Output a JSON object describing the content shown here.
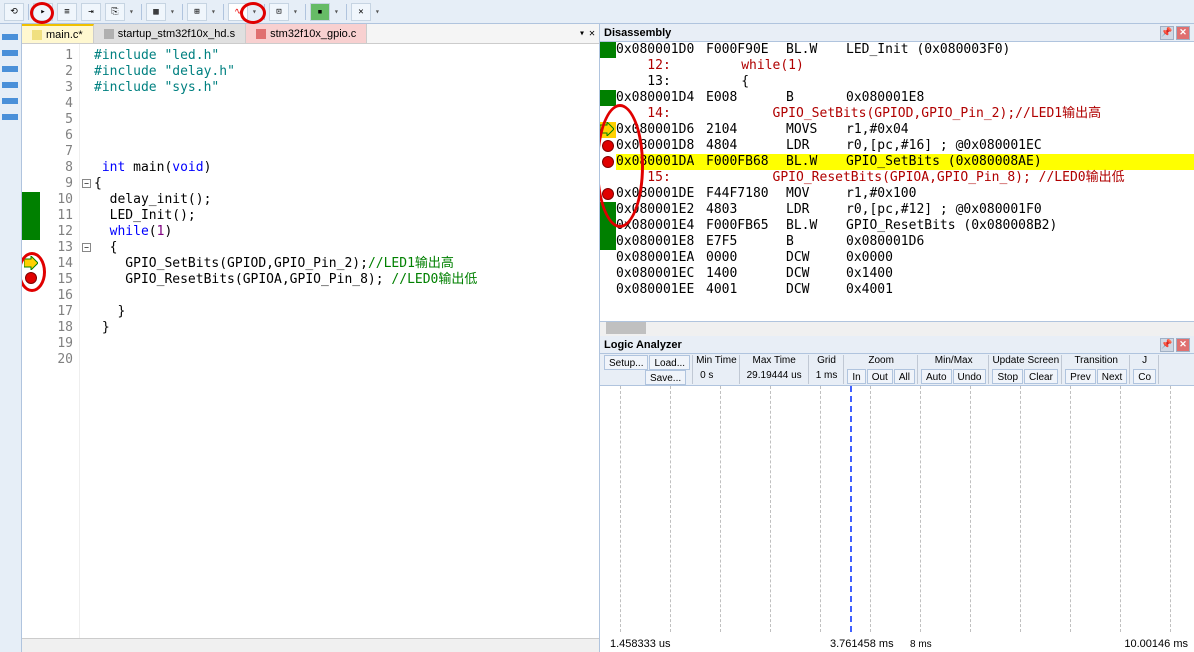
{
  "toolbar": {
    "icons": [
      "reset-icon",
      "run-icon",
      "list-icon",
      "trace-icon",
      "step-icon",
      "window-icon",
      "reg-icon",
      "mem-icon",
      "analyzer-icon",
      "scope-icon",
      "cov-icon",
      "perf-icon",
      "trace2-icon",
      "tools-icon"
    ]
  },
  "tabs": [
    {
      "label": "main.c*",
      "active": true
    },
    {
      "label": "startup_stm32f10x_hd.s",
      "cls": "gray"
    },
    {
      "label": "stm32f10x_gpio.c",
      "cls": "pink"
    }
  ],
  "code": {
    "lines": [
      {
        "n": 1,
        "seg": [
          {
            "t": "#include ",
            "c": "kw-pp"
          },
          {
            "t": "\"led.h\"",
            "c": "kw-str"
          }
        ]
      },
      {
        "n": 2,
        "seg": [
          {
            "t": "#include ",
            "c": "kw-pp"
          },
          {
            "t": "\"delay.h\"",
            "c": "kw-str"
          }
        ]
      },
      {
        "n": 3,
        "seg": [
          {
            "t": "#include ",
            "c": "kw-pp"
          },
          {
            "t": "\"sys.h\"",
            "c": "kw-str"
          }
        ]
      },
      {
        "n": 4,
        "seg": []
      },
      {
        "n": 5,
        "seg": []
      },
      {
        "n": 6,
        "seg": []
      },
      {
        "n": 7,
        "seg": []
      },
      {
        "n": 8,
        "seg": [
          {
            "t": " int ",
            "c": "kw-blue"
          },
          {
            "t": "main",
            "c": ""
          },
          {
            "t": "(",
            "c": ""
          },
          {
            "t": "void",
            "c": "kw-blue"
          },
          {
            "t": ")",
            "c": ""
          }
        ]
      },
      {
        "n": 9,
        "seg": [
          {
            "t": "{",
            "c": ""
          }
        ],
        "fold": true
      },
      {
        "n": 10,
        "seg": [
          {
            "t": "  delay_init();",
            "c": ""
          }
        ]
      },
      {
        "n": 11,
        "seg": [
          {
            "t": "  LED_Init();",
            "c": ""
          }
        ]
      },
      {
        "n": 12,
        "seg": [
          {
            "t": "  ",
            "c": ""
          },
          {
            "t": "while",
            "c": "kw-blue"
          },
          {
            "t": "(",
            "c": ""
          },
          {
            "t": "1",
            "c": "kw-pr"
          },
          {
            "t": ")",
            "c": ""
          }
        ]
      },
      {
        "n": 13,
        "seg": [
          {
            "t": "  {",
            "c": ""
          }
        ],
        "fold": true
      },
      {
        "n": 14,
        "seg": [
          {
            "t": "    GPIO_SetBits(GPIOD,GPIO_Pin_2);",
            "c": ""
          },
          {
            "t": "//LED1输出高",
            "c": "kw-cm"
          }
        ]
      },
      {
        "n": 15,
        "seg": [
          {
            "t": "    GPIO_ResetBits(GPIOA,GPIO_Pin_8); ",
            "c": ""
          },
          {
            "t": "//LED0输出低",
            "c": "kw-cm"
          }
        ]
      },
      {
        "n": 16,
        "seg": []
      },
      {
        "n": 17,
        "seg": [
          {
            "t": "   }",
            "c": ""
          }
        ]
      },
      {
        "n": 18,
        "seg": [
          {
            "t": " }",
            "c": ""
          }
        ]
      },
      {
        "n": 19,
        "seg": []
      },
      {
        "n": 20,
        "seg": []
      }
    ]
  },
  "disasm": {
    "title": "Disassembly",
    "lines": [
      {
        "g": "green",
        "addr": "0x080001D0",
        "hex": "F000F90E",
        "op": "BL.W",
        "args": "LED_Init (0x080003F0)"
      },
      {
        "src": true,
        "t": "    12:         while(1)",
        "c": "dl-red-txt"
      },
      {
        "src": true,
        "t": "    13:         {"
      },
      {
        "g": "green",
        "addr": "0x080001D4",
        "hex": "E008",
        "op": "B",
        "args": "0x080001E8"
      },
      {
        "src": true,
        "t": "    14:             GPIO_SetBits(GPIOD,GPIO_Pin_2);//LED1输出高",
        "c": "dl-red-txt"
      },
      {
        "g": "arrow",
        "addr": "0x080001D6",
        "hex": "2104",
        "op": "MOVS",
        "args": "r1,#0x04"
      },
      {
        "g": "red",
        "addr": "0x080001D8",
        "hex": "4804",
        "op": "LDR",
        "args": "r0,[pc,#16]  ; @0x080001EC"
      },
      {
        "g": "red",
        "hl": true,
        "addr": "0x080001DA",
        "hex": "F000FB68",
        "op": "BL.W",
        "args": "GPIO_SetBits (0x080008AE)"
      },
      {
        "src": true,
        "t": "    15:             GPIO_ResetBits(GPIOA,GPIO_Pin_8); //LED0输出低",
        "c": "dl-red-txt"
      },
      {
        "g": "red",
        "addr": "0x080001DE",
        "hex": "F44F7180",
        "op": "MOV",
        "args": "r1,#0x100"
      },
      {
        "g": "green",
        "addr": "0x080001E2",
        "hex": "4803",
        "op": "LDR",
        "args": "r0,[pc,#12]  ; @0x080001F0"
      },
      {
        "g": "green",
        "addr": "0x080001E4",
        "hex": "F000FB65",
        "op": "BL.W",
        "args": "GPIO_ResetBits (0x080008B2)"
      },
      {
        "g": "green",
        "addr": "0x080001E8",
        "hex": "E7F5",
        "op": "B",
        "args": "0x080001D6"
      },
      {
        "addr": "0x080001EA",
        "hex": "0000",
        "op": "DCW",
        "args": "0x0000"
      },
      {
        "addr": "0x080001EC",
        "hex": "1400",
        "op": "DCW",
        "args": "0x1400"
      },
      {
        "addr": "0x080001EE",
        "hex": "4001",
        "op": "DCW",
        "args": "0x4001"
      }
    ]
  },
  "logic": {
    "title": "Logic Analyzer",
    "setup": "Setup...",
    "load": "Load...",
    "save": "Save...",
    "mintime_label": "Min Time",
    "mintime": "0 s",
    "maxtime_label": "Max Time",
    "maxtime": "29.19444 us",
    "grid_label": "Grid",
    "grid": "1 ms",
    "zoom_label": "Zoom",
    "zoom_in": "In",
    "zoom_out": "Out",
    "zoom_all": "All",
    "minmax_label": "Min/Max",
    "auto": "Auto",
    "undo": "Undo",
    "update_label": "Update Screen",
    "stop": "Stop",
    "clear": "Clear",
    "trans_label": "Transition",
    "prev": "Prev",
    "next": "Next",
    "j": "J",
    "co": "Co",
    "status_left": "1.458333 us",
    "status_mid": "3.761458 ms",
    "status_mid2": "8 ms",
    "status_right": "10.00146 ms"
  }
}
